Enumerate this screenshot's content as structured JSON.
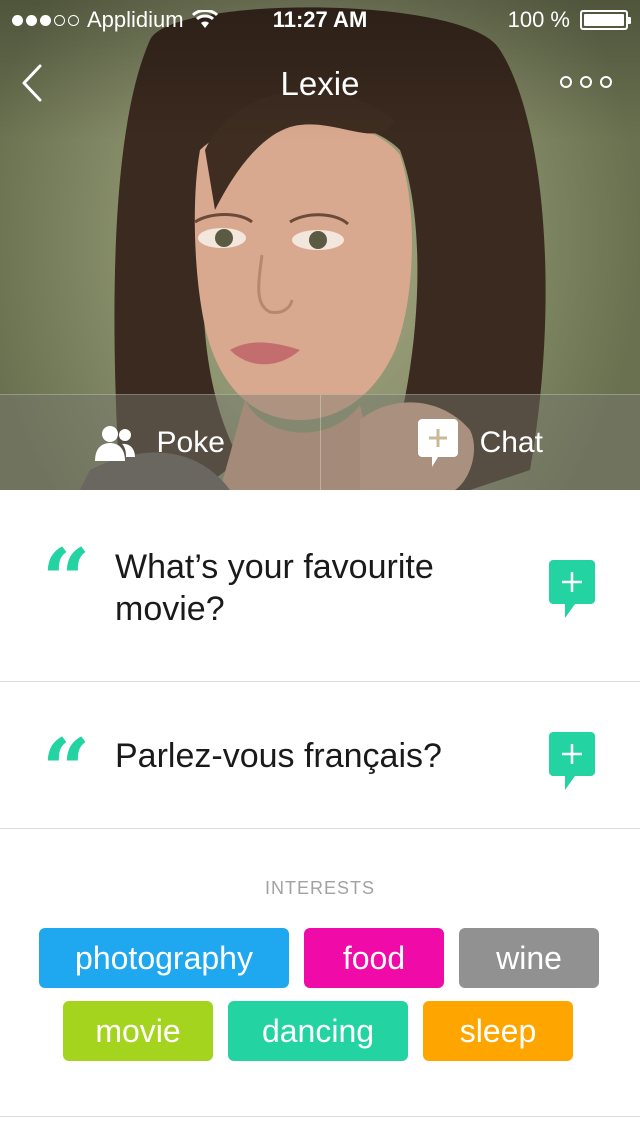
{
  "status_bar": {
    "carrier": "Applidium",
    "time": "11:27 AM",
    "battery": "100 %",
    "battery_level": 1.0,
    "signal_bars": 3,
    "signal_total": 5
  },
  "nav": {
    "title": "Lexie",
    "back_icon": "chevron-left-icon",
    "more_icon": "more-dots-icon"
  },
  "actions": {
    "poke_label": "Poke",
    "poke_icon": "people-icon",
    "chat_label": "Chat",
    "chat_icon": "chat-add-icon"
  },
  "questions": [
    {
      "text": "What’s your favourite movie?",
      "icon": "chat-add-icon"
    },
    {
      "text": "Parlez-vous français?",
      "icon": "chat-add-icon"
    }
  ],
  "interests": {
    "title": "INTERESTS",
    "tags": [
      {
        "label": "photography",
        "color": "#1fa8ef"
      },
      {
        "label": "food",
        "color": "#f00aa8"
      },
      {
        "label": "wine",
        "color": "#919191"
      },
      {
        "label": "movie",
        "color": "#a5d41e"
      },
      {
        "label": "dancing",
        "color": "#23d3a1"
      },
      {
        "label": "sleep",
        "color": "#ffa500"
      }
    ]
  },
  "colors": {
    "accent": "#23d3a1",
    "divider": "#dcdcdc",
    "muted_text": "#a2a2a2"
  }
}
